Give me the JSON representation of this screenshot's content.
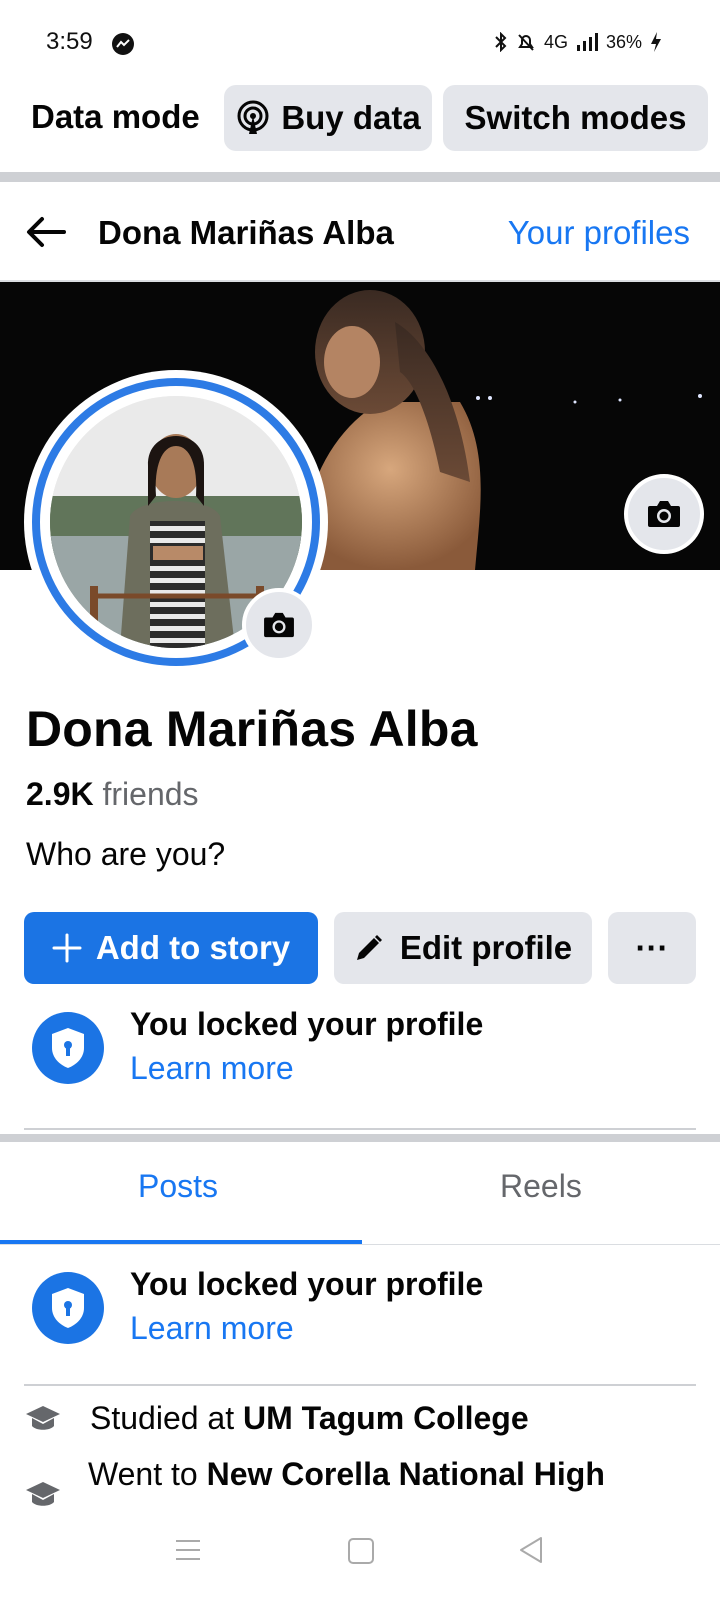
{
  "status_bar": {
    "time": "3:59",
    "network": "4G",
    "battery": "36%"
  },
  "data_mode": {
    "label": "Data mode",
    "buy_label": "Buy data",
    "switch_label": "Switch modes"
  },
  "header": {
    "title": "Dona Mariñas Alba",
    "your_profiles": "Your profiles"
  },
  "profile": {
    "name": "Dona Mariñas Alba",
    "friends_count": "2.9K",
    "friends_word": "friends",
    "bio": "Who are you?"
  },
  "actions": {
    "add_story": "Add to story",
    "edit_profile": "Edit profile",
    "more": "···"
  },
  "locked_notice": {
    "title": "You locked your profile",
    "link": "Learn more"
  },
  "tabs": [
    {
      "label": "Posts",
      "active": true
    },
    {
      "label": "Reels",
      "active": false
    }
  ],
  "details": [
    {
      "prefix": "Studied at ",
      "bold": "UM Tagum College"
    },
    {
      "prefix": "Went to ",
      "bold": "New Corella National High"
    }
  ],
  "colors": {
    "accent": "#1877f2",
    "button_blue": "#1b74e4",
    "button_gray": "#e4e6eb"
  }
}
